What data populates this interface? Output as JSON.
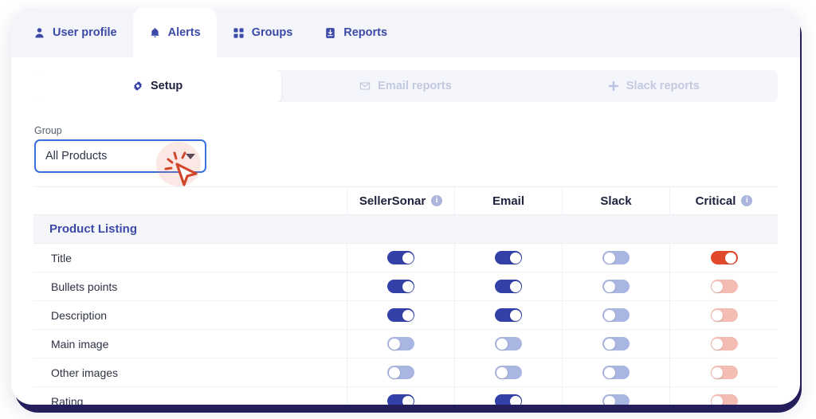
{
  "theme": {
    "accent_blue": "#3b4aa8",
    "toggle_on_blue": "#3240a8",
    "toggle_off_blue": "#aab6e2",
    "toggle_on_red": "#e2492c",
    "toggle_off_red": "#f4bdb3",
    "select_border": "#3b6ddb",
    "frame_navy": "#251f5c"
  },
  "tabs": [
    {
      "label": "User profile",
      "icon": "user-icon",
      "active": false
    },
    {
      "label": "Alerts",
      "icon": "bell-icon",
      "active": true
    },
    {
      "label": "Groups",
      "icon": "grid-icon",
      "active": false
    },
    {
      "label": "Reports",
      "icon": "report-download-icon",
      "active": false
    }
  ],
  "subtabs": [
    {
      "label": "Setup",
      "icon": "gear-icon",
      "active": true
    },
    {
      "label": "Email reports",
      "icon": "envelope-icon",
      "active": false
    },
    {
      "label": "Slack reports",
      "icon": "slack-icon",
      "active": false
    }
  ],
  "group_select": {
    "label": "Group",
    "value": "All Products",
    "placeholder": "All Products",
    "caret_icon": "chevron-down-icon"
  },
  "table": {
    "columns": [
      {
        "label": "",
        "info": false
      },
      {
        "label": "SellerSonar",
        "info": true
      },
      {
        "label": "Email",
        "info": false
      },
      {
        "label": "Slack",
        "info": false
      },
      {
        "label": "Critical",
        "info": true
      }
    ],
    "sections": [
      {
        "title": "Product Listing",
        "rows": [
          {
            "name": "Title",
            "sellersonar": "on",
            "email": "on",
            "slack": "off",
            "critical": "on"
          },
          {
            "name": "Bullets points",
            "sellersonar": "on",
            "email": "on",
            "slack": "off",
            "critical": "off"
          },
          {
            "name": "Description",
            "sellersonar": "on",
            "email": "on",
            "slack": "off",
            "critical": "off"
          },
          {
            "name": "Main image",
            "sellersonar": "off",
            "email": "off",
            "slack": "off",
            "critical": "off"
          },
          {
            "name": "Other images",
            "sellersonar": "off",
            "email": "off",
            "slack": "off",
            "critical": "off"
          },
          {
            "name": "Rating",
            "sellersonar": "on",
            "email": "on",
            "slack": "off",
            "critical": "off"
          }
        ]
      }
    ]
  },
  "cursor": {
    "icon": "click-cursor-icon",
    "state": "clicking"
  }
}
